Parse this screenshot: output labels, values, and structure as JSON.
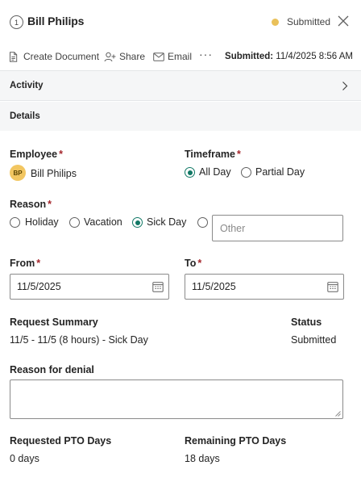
{
  "header": {
    "step_number": "1",
    "title": "Bill Philips",
    "status": "Submitted",
    "status_color": "#eac15a"
  },
  "toolbar": {
    "create_document": "Create Document",
    "share": "Share",
    "email": "Email",
    "more": "···",
    "submitted_label": "Submitted:",
    "submitted_value": "11/4/2025 8:56 AM"
  },
  "sections": {
    "activity": "Activity",
    "details": "Details"
  },
  "form": {
    "employee": {
      "label": "Employee",
      "required_mark": "*",
      "avatar_initials": "BP",
      "value": "Bill Philips"
    },
    "timeframe": {
      "label": "Timeframe",
      "required_mark": "*",
      "options": [
        "All Day",
        "Partial Day"
      ],
      "selected": "All Day"
    },
    "reason": {
      "label": "Reason",
      "required_mark": "*",
      "options": [
        "Holiday",
        "Vacation",
        "Sick Day"
      ],
      "selected": "Sick Day",
      "other_placeholder": "Other"
    },
    "from": {
      "label": "From",
      "required_mark": "*",
      "value": "11/5/2025"
    },
    "to": {
      "label": "To",
      "required_mark": "*",
      "value": "11/5/2025"
    },
    "request_summary": {
      "label": "Request Summary",
      "value": "11/5 - 11/5 (8 hours) - Sick Day"
    },
    "status": {
      "label": "Status",
      "value": "Submitted"
    },
    "reason_for_denial": {
      "label": "Reason for denial",
      "value": ""
    },
    "requested_pto": {
      "label": "Requested PTO Days",
      "value": "0 days"
    },
    "remaining_pto": {
      "label": "Remaining PTO Days",
      "value": "18 days"
    }
  },
  "colors": {
    "accent": "#117865",
    "required": "#a4262c",
    "section_background": "#f5f6f7"
  }
}
